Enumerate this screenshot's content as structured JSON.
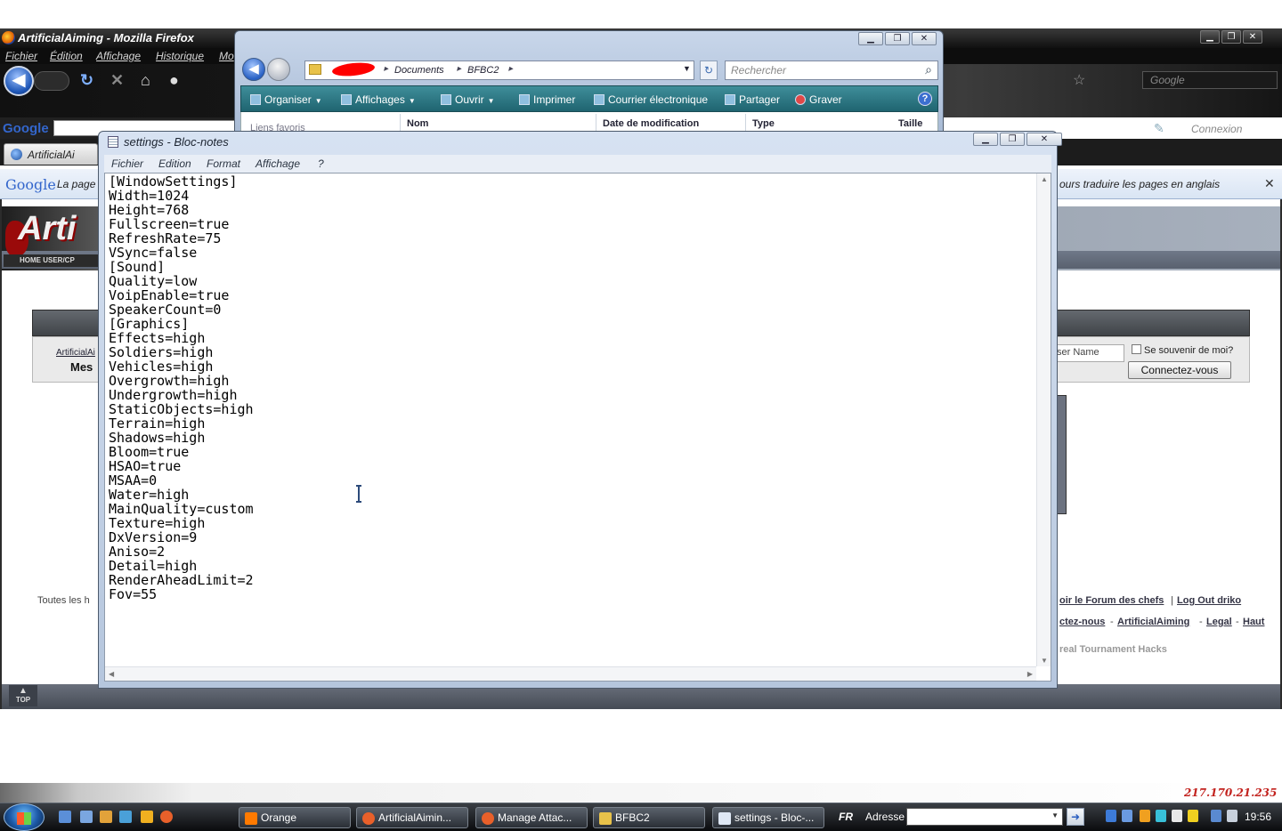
{
  "firefox": {
    "title": "ArtificialAiming - Mozilla Firefox",
    "menu": [
      "Fichier",
      "Édition",
      "Affichage",
      "Historique",
      "Mo"
    ],
    "search_placeholder": "Google",
    "connexion_label": "Connexion",
    "google_label": "Google",
    "tab_label": "ArtificialAi",
    "translate_logo": "Google",
    "translate_left": "La page",
    "translate_right": "ours traduire les pages en anglais",
    "translate_close": "✕"
  },
  "forum": {
    "logo_text": "Arti",
    "nav_text": "HOME  USER/CP",
    "breadcrumb_root": "ArtificialAi",
    "breadcrumb_current": "Mes",
    "username_placeholder": "ser Name",
    "remember_label": "Se souvenir de moi?",
    "login_button": "Connectez-vous",
    "footer_left": "Toutes les h",
    "footer_link_chefs": "oir le Forum des chefs",
    "footer_link_logout": "Log Out driko",
    "footer_sep_pipe": "|",
    "footer_link_contact": "ctez-nous",
    "footer_link_site": "ArtificialAiming",
    "footer_link_legal": "Legal",
    "footer_link_top": "Haut",
    "footer_sep_dash": "-",
    "footer_tagline": "real Tournament Hacks",
    "top_button": "TOP"
  },
  "explorer": {
    "breadcrumb": [
      "Documents",
      "BFBC2"
    ],
    "search_placeholder": "Rechercher",
    "toolbar": [
      "Organiser",
      "Affichages",
      "Ouvrir",
      "Imprimer",
      "Courrier électronique",
      "Partager",
      "Graver"
    ],
    "favorites_label": "Liens favoris",
    "columns": [
      "Nom",
      "Date de modification",
      "Type",
      "Taille"
    ]
  },
  "notepad": {
    "title": "settings - Bloc-notes",
    "menu": [
      "Fichier",
      "Edition",
      "Format",
      "Affichage",
      "?"
    ],
    "content": "[WindowSettings]\nWidth=1024\nHeight=768\nFullscreen=true\nRefreshRate=75\nVSync=false\n[Sound]\nQuality=low\nVoipEnable=true\nSpeakerCount=0\n[Graphics]\nEffects=high\nSoldiers=high\nVehicles=high\nOvergrowth=high\nUndergrowth=high\nStaticObjects=high\nTerrain=high\nShadows=high\nBloom=true\nHSAO=true\nMSAA=0\nWater=high\nMainQuality=custom\nTexture=high\nDxVersion=9\nAniso=2\nDetail=high\nRenderAheadLimit=2\nFov=55"
  },
  "desktop": {
    "ip": "217.170.21.235"
  },
  "taskbar": {
    "tasks": [
      "Orange",
      "ArtificialAimin...",
      "Manage Attac...",
      "BFBC2",
      "settings - Bloc-..."
    ],
    "language": "FR",
    "address_label": "Adresse",
    "clock": "19:56"
  },
  "colors": {
    "taskbar_bg": "#0a0b0d",
    "explorer_toolbar": "#1f6470",
    "notepad_frame": "#b5c6dd",
    "ip_text": "#c2211d"
  }
}
